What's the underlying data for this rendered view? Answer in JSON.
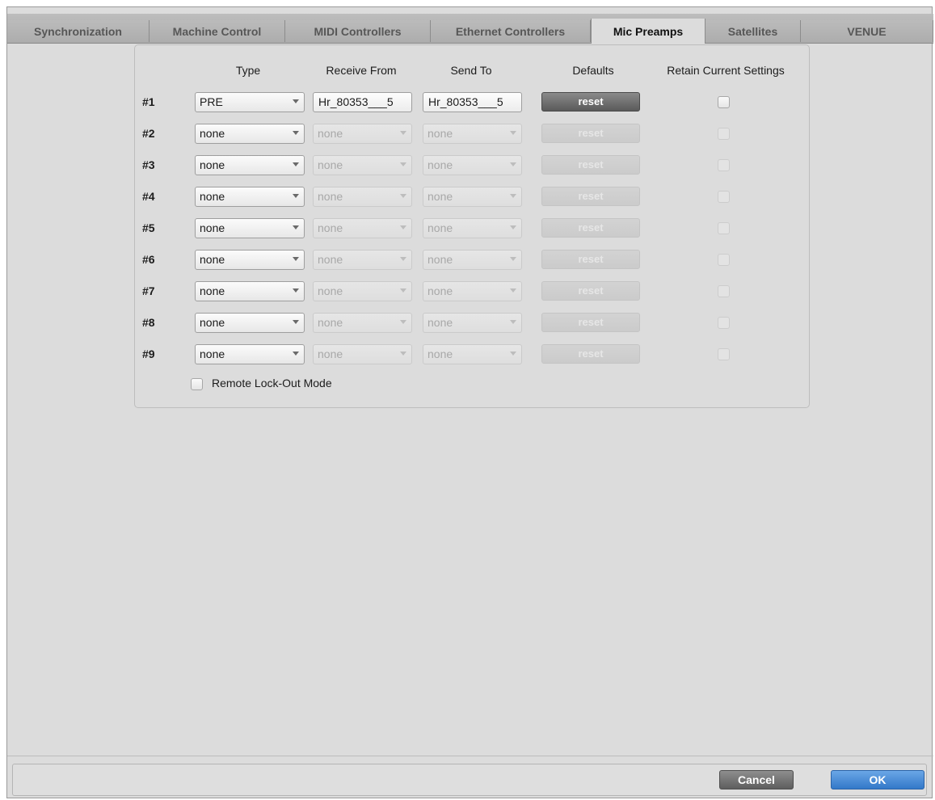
{
  "tabs": [
    {
      "label": "Synchronization",
      "active": false
    },
    {
      "label": "Machine Control",
      "active": false
    },
    {
      "label": "MIDI Controllers",
      "active": false
    },
    {
      "label": "Ethernet Controllers",
      "active": false
    },
    {
      "label": "Mic Preamps",
      "active": true
    },
    {
      "label": "Satellites",
      "active": false
    },
    {
      "label": "VENUE",
      "active": false
    }
  ],
  "columns": {
    "type": "Type",
    "receive_from": "Receive From",
    "send_to": "Send To",
    "defaults": "Defaults",
    "retain": "Retain Current Settings"
  },
  "rows": [
    {
      "label": "#1",
      "type": "PRE",
      "receive_from": "Hr_80353___5",
      "send_to": "Hr_80353___5",
      "reset": "reset",
      "enabled": true
    },
    {
      "label": "#2",
      "type": "none",
      "receive_from": "none",
      "send_to": "none",
      "reset": "reset",
      "enabled": false
    },
    {
      "label": "#3",
      "type": "none",
      "receive_from": "none",
      "send_to": "none",
      "reset": "reset",
      "enabled": false
    },
    {
      "label": "#4",
      "type": "none",
      "receive_from": "none",
      "send_to": "none",
      "reset": "reset",
      "enabled": false
    },
    {
      "label": "#5",
      "type": "none",
      "receive_from": "none",
      "send_to": "none",
      "reset": "reset",
      "enabled": false
    },
    {
      "label": "#6",
      "type": "none",
      "receive_from": "none",
      "send_to": "none",
      "reset": "reset",
      "enabled": false
    },
    {
      "label": "#7",
      "type": "none",
      "receive_from": "none",
      "send_to": "none",
      "reset": "reset",
      "enabled": false
    },
    {
      "label": "#8",
      "type": "none",
      "receive_from": "none",
      "send_to": "none",
      "reset": "reset",
      "enabled": false
    },
    {
      "label": "#9",
      "type": "none",
      "receive_from": "none",
      "send_to": "none",
      "reset": "reset",
      "enabled": false
    }
  ],
  "remote_lockout": {
    "label": "Remote Lock-Out Mode",
    "checked": false
  },
  "footer": {
    "cancel": "Cancel",
    "ok": "OK"
  },
  "colors": {
    "ok_accent": "#3379c9",
    "window_bg": "#dcdcdc"
  }
}
